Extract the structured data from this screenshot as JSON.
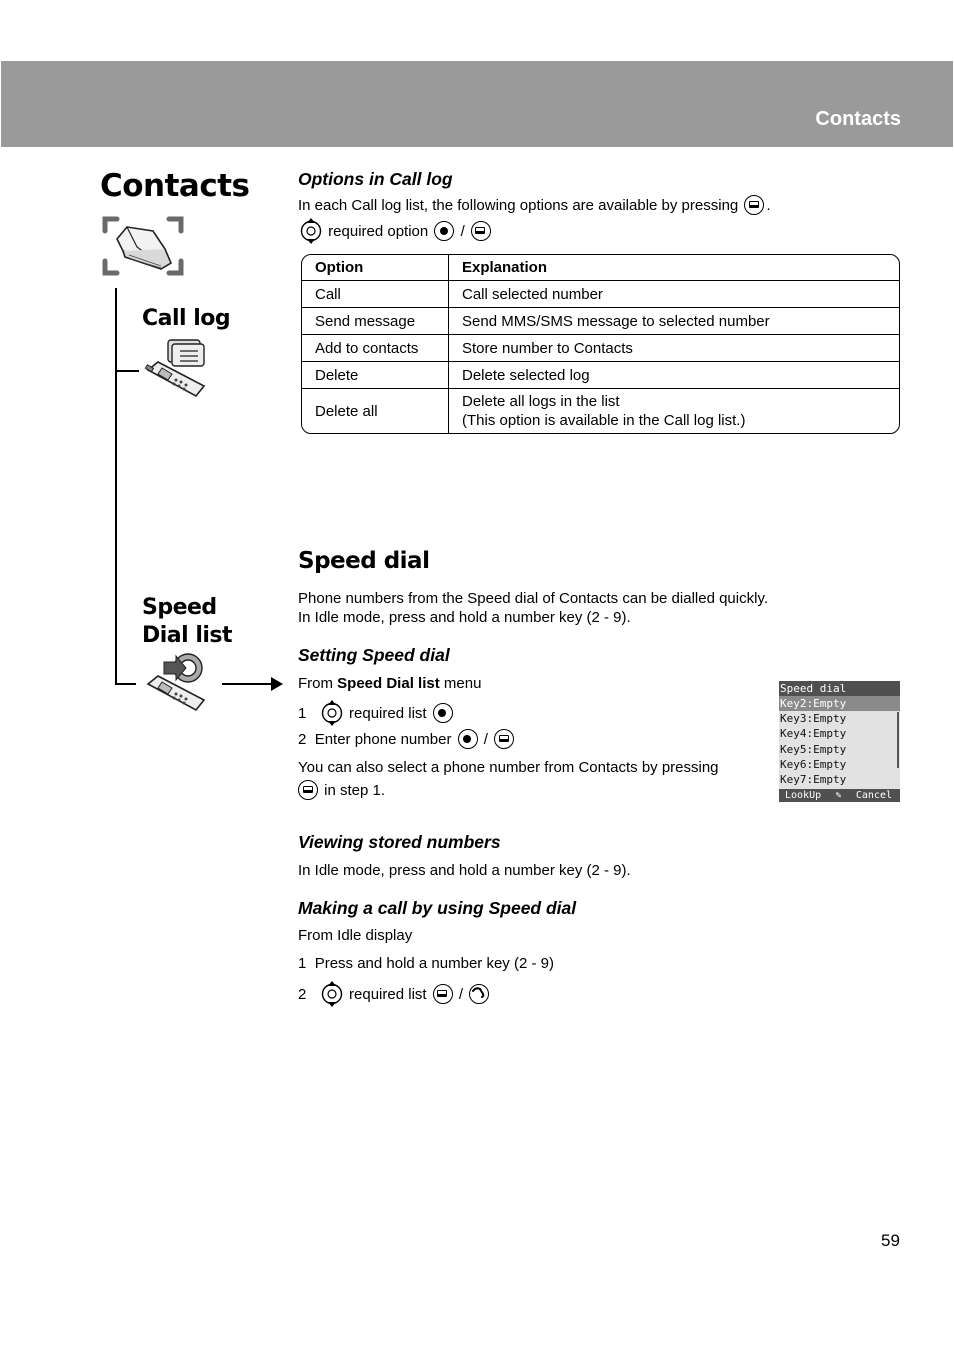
{
  "header": {
    "section_title": "Contacts"
  },
  "sidebar": {
    "page_title": "Contacts",
    "call_log_label": "Call log",
    "speed_dial_label_line1": "Speed",
    "speed_dial_label_line2": "Dial list"
  },
  "call_log_options": {
    "heading": "Options in Call log",
    "intro_prefix": "In each Call log list, the following options are available by pressing",
    "intro_suffix": ".",
    "instruction_text": "required option",
    "separator": "/",
    "table": {
      "headers": [
        "Option",
        "Explanation"
      ],
      "rows": [
        {
          "option": "Call",
          "explanation": "Call selected number"
        },
        {
          "option": "Send message",
          "explanation": "Send MMS/SMS message to selected number"
        },
        {
          "option": "Add to contacts",
          "explanation": "Store number to Contacts"
        },
        {
          "option": "Delete",
          "explanation": "Delete selected log"
        },
        {
          "option": "Delete all",
          "explanation": "Delete all logs in the list",
          "explanation_line2": "(This option is available in the Call log list.)"
        }
      ]
    }
  },
  "speed_dial": {
    "heading": "Speed dial",
    "intro_line1": "Phone numbers from the Speed dial of Contacts can be dialled quickly.",
    "intro_line2": "In Idle mode, press and hold a number key (2 - 9).",
    "setting": {
      "heading": "Setting Speed dial",
      "from_prefix": "From",
      "from_bold": "Speed Dial list",
      "from_suffix": "menu",
      "step1_num": "1",
      "step1_text": "required list",
      "step2_num": "2",
      "step2_text": "Enter phone number",
      "separator": "/",
      "note_line1": "You can also select a phone number from Contacts by pressing",
      "note_line2": "in step 1."
    },
    "viewing": {
      "heading": "Viewing stored numbers",
      "text": "In Idle mode, press and hold a number key (2 - 9)."
    },
    "making_call": {
      "heading": "Making a call by using Speed dial",
      "from_text": "From Idle display",
      "step1_num": "1",
      "step1_text": "Press and hold a number key (2 - 9)",
      "step2_num": "2",
      "step2_text": "required list",
      "separator": "/"
    },
    "screen": {
      "title": "Speed dial",
      "items": [
        "Key2:Empty",
        "Key3:Empty",
        "Key4:Empty",
        "Key5:Empty",
        "Key6:Empty",
        "Key7:Empty"
      ],
      "selected_index": 0,
      "softkey_left": "LookUp",
      "softkey_center": "✎",
      "softkey_right": "Cancel"
    }
  },
  "footer": {
    "page_number": "59"
  }
}
